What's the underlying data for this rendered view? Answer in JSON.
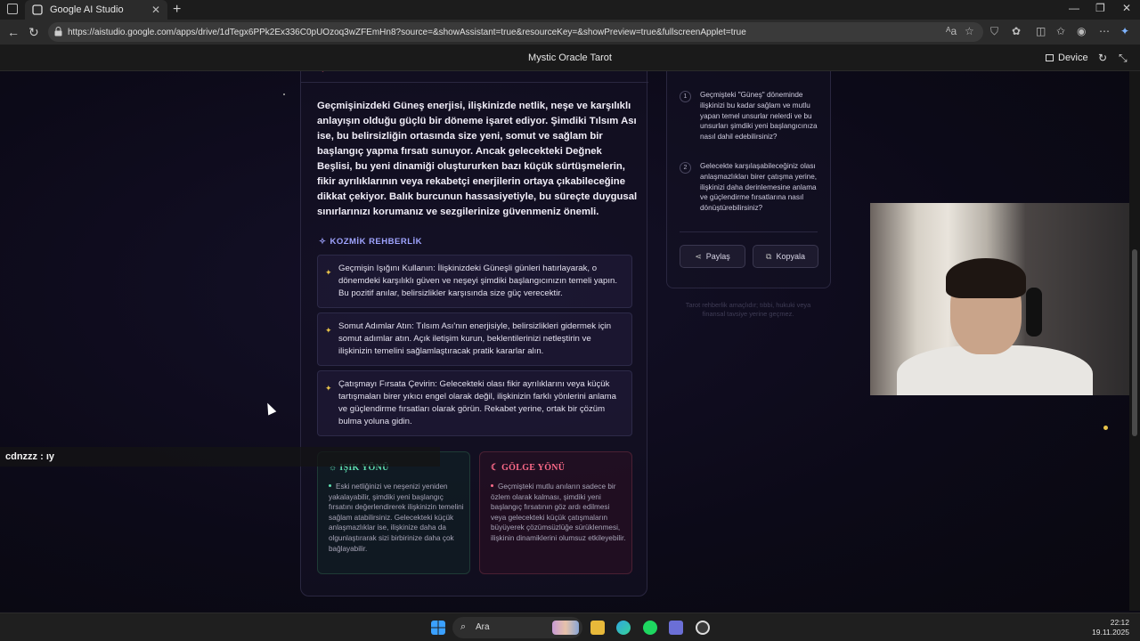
{
  "browser": {
    "tab_title": "Google AI Studio",
    "url": "https://aistudio.google.com/apps/drive/1dTegx6PPk2Ex336C0pUOzoq3wZFEmHn8?source=&showAssistant=true&resourceKey=&showPreview=true&fullscreenApplet=true"
  },
  "app": {
    "title": "Mystic Oracle Tarot",
    "device_label": "Device"
  },
  "reading": {
    "paragraph": "Geçmişinizdeki Güneş enerjisi, ilişkinizde netlik, neşe ve karşılıklı anlayışın olduğu güçlü bir döneme işaret ediyor. Şimdiki Tılsım Ası ise, bu belirsizliğin ortasında size yeni, somut ve sağlam bir başlangıç yapma fırsatı sunuyor. Ancak gelecekteki Değnek Beşlisi, bu yeni dinamiği oluştururken bazı küçük sürtüşmelerin, fikir ayrılıklarının veya rekabetçi enerjilerin ortaya çıkabileceğine dikkat çekiyor. Balık burcunun hassasiyetiyle, bu süreçte duygusal sınırlarınızı korumanız ve sezgilerinize güvenmeniz önemli.",
    "guidance_title": "KOZMİK REHBERLİK",
    "tips": [
      "Geçmişin Işığını Kullanın: İlişkinizdeki Güneşli günleri hatırlayarak, o dönemdeki karşılıklı güven ve neşeyi şimdiki başlangıcınızın temeli yapın. Bu pozitif anılar, belirsizlikler karşısında size güç verecektir.",
      "Somut Adımlar Atın: Tılsım Ası'nın enerjisiyle, belirsizlikleri gidermek için somut adımlar atın. Açık iletişim kurun, beklentilerinizi netleştirin ve ilişkinizin temelini sağlamlaştıracak pratik kararlar alın.",
      "Çatışmayı Fırsata Çevirin: Gelecekteki olası fikir ayrılıklarını veya küçük tartışmaları birer yıkıcı engel olarak değil, ilişkinizin farklı yönlerini anlama ve güçlendirme fırsatları olarak görün. Rekabet yerine, ortak bir çözüm bulma yoluna gidin."
    ],
    "light_title": "IŞIK YÖNÜ",
    "light_text": "Eski netliğinizi ve neşenizi yeniden yakalayabilir, şimdiki yeni başlangıç fırsatını değerlendirerek ilişkinizin temelini sağlam atabilirsiniz. Gelecekteki küçük anlaşmazlıklar ise, ilişkinize daha da olgunlaştırarak sizi birbirinize daha çok bağlayabilir.",
    "shadow_title": "GÖLGE YÖNÜ",
    "shadow_text": "Geçmişteki mutlu anıların sadece bir özlem olarak kalması, şimdiki yeni başlangıç fırsatının göz ardı edilmesi veya gelecekteki küçük çatışmaların büyüyerek çözümsüzlüğe sürüklenmesi, ilişkinin dinamiklerini olumsuz etkileyebilir."
  },
  "questions": [
    {
      "num": "1",
      "text": "Geçmişteki \"Güneş\" döneminde ilişkinizi bu kadar sağlam ve mutlu yapan temel unsurlar nelerdi ve bu unsurları şimdiki yeni başlangıcınıza nasıl dahil edebilirsiniz?"
    },
    {
      "num": "2",
      "text": "Gelecekte karşılaşabileceğiniz olası anlaşmazlıkları birer çatışma yerine, ilişkinizi daha derinlemesine anlama ve güçlendirme fırsatlarına nasıl dönüştürebilirsiniz?"
    }
  ],
  "actions": {
    "share": "Paylaş",
    "copy": "Kopyala"
  },
  "disclaimer": "Tarot rehberlik amaçlıdır; tıbbi, hukuki veya finansal tavsiye yerine geçmez.",
  "chat": {
    "line": "cdnzzz : ıy"
  },
  "taskbar": {
    "search_label": "Ara",
    "time": "22:12",
    "date": "19.11.2025"
  },
  "colors": {
    "accent_star": "#e8c34a",
    "guidance": "#9fa4ff",
    "light": "#5fe0b0",
    "shadow": "#ff6b8a"
  }
}
